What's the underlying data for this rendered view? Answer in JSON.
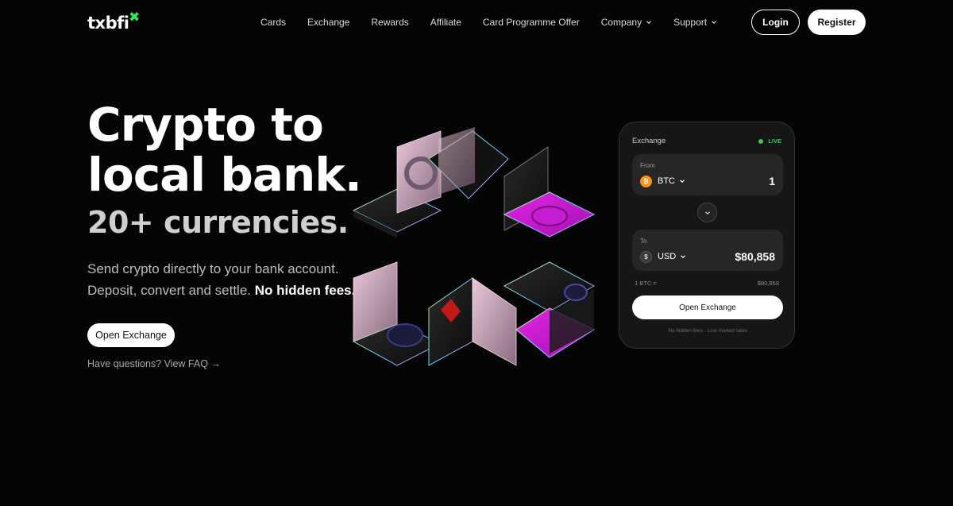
{
  "nav": {
    "logo": "txbfi",
    "logo_mark": "✖",
    "links": [
      {
        "label": "Cards",
        "dropdown": false
      },
      {
        "label": "Exchange",
        "dropdown": false
      },
      {
        "label": "Rewards",
        "dropdown": false
      },
      {
        "label": "Affiliate",
        "dropdown": false
      },
      {
        "label": "Card Programme Offer",
        "dropdown": false
      },
      {
        "label": "Company",
        "dropdown": true
      },
      {
        "label": "Support",
        "dropdown": true
      }
    ],
    "login_label": "Login",
    "register_label": "Register"
  },
  "hero": {
    "title_line1": "Crypto to",
    "title_line2": "local bank.",
    "subtitle": "20+ currencies.",
    "desc_line1": "Send crypto directly to your bank account.",
    "desc_line2": "Deposit, convert and settle.",
    "desc_bold": "No hidden fees.",
    "cta_label": "Open Exchange",
    "faq_label": "Have questions? View FAQ →"
  },
  "exchange_card": {
    "title": "Exchange",
    "live_label": "LIVE",
    "from_label": "From",
    "from_currency": "BTC",
    "from_icon": "₿",
    "from_amount": "1",
    "to_label": "To",
    "to_currency": "USD",
    "to_icon": "$",
    "to_amount": "$80,858",
    "rate_left": "1 BTC =",
    "rate_right": "$80,858",
    "button_label": "Open Exchange",
    "footer_note": "No hidden fees · Live market rates"
  },
  "colors": {
    "accent_green": "#2ee85a",
    "btc_orange": "#f7931a",
    "magenta": "#d21cd8",
    "background": "#050505"
  }
}
